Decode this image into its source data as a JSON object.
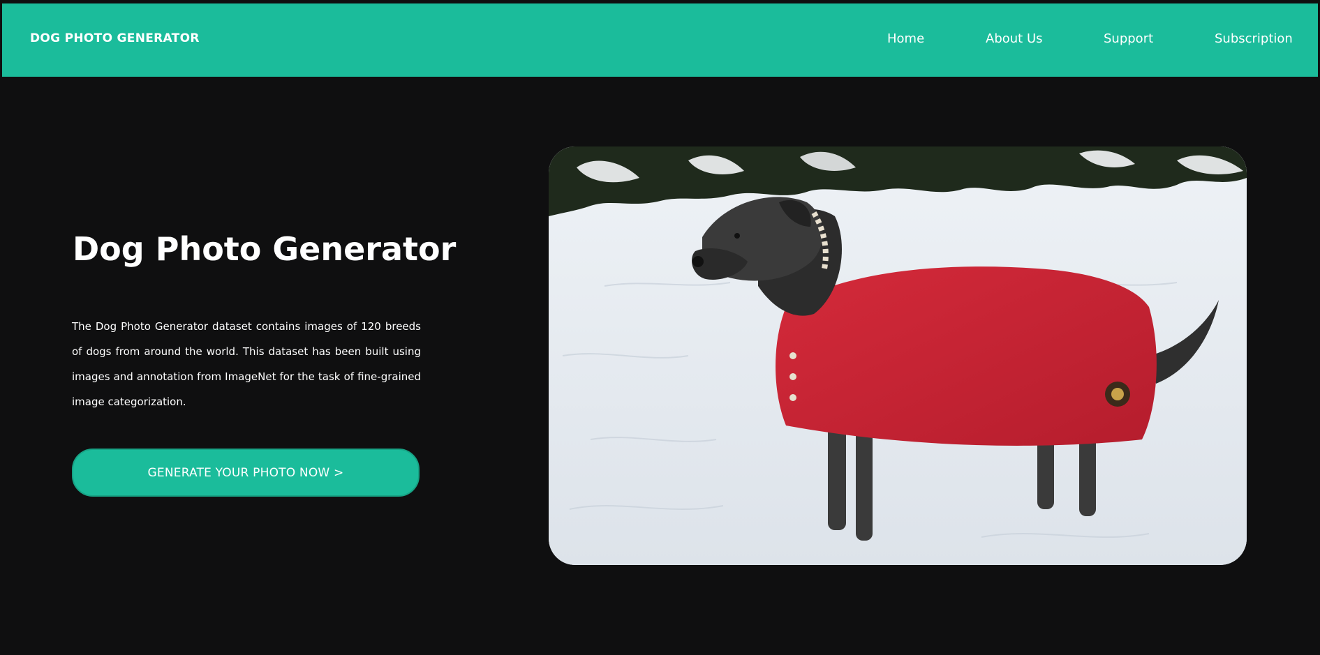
{
  "header": {
    "brand": "DOG PHOTO GENERATOR",
    "nav": [
      {
        "label": "Home"
      },
      {
        "label": "About Us"
      },
      {
        "label": "Support"
      },
      {
        "label": "Subscription"
      }
    ]
  },
  "hero": {
    "title": "Dog Photo Generator",
    "description": "The Dog Photo Generator dataset contains images of 120 breeds of dogs from around the world. This dataset has been built using images and annotation from ImageNet for the task of fine-grained image categorization.",
    "cta_label": "GENERATE YOUR PHOTO NOW >",
    "image_subject": "scruffy grey dog in red coat standing in snow"
  },
  "colors": {
    "accent": "#1bbc9b",
    "background": "#0f0f10",
    "text": "#ffffff"
  }
}
